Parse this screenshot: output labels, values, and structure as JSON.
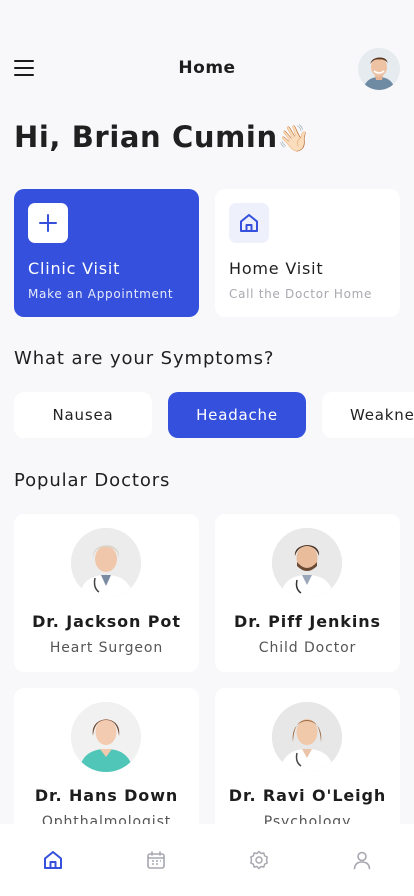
{
  "header": {
    "title": "Home",
    "menu_icon": "hamburger-menu-icon",
    "avatar_icon": "user-avatar"
  },
  "greeting": {
    "text": "Hi, Brian Cumin",
    "emoji": "👋🏻"
  },
  "visits": [
    {
      "title": "Clinic Visit",
      "subtitle": "Make an Appointment",
      "icon": "plus-icon",
      "active": true
    },
    {
      "title": "Home Visit",
      "subtitle": "Call the Doctor Home",
      "icon": "house-icon",
      "active": false
    }
  ],
  "symptoms": {
    "title": "What are your Symptoms?",
    "items": [
      {
        "label": "Nausea",
        "active": false
      },
      {
        "label": "Headache",
        "active": true
      },
      {
        "label": "Weakne",
        "active": false
      }
    ]
  },
  "doctors": {
    "title": "Popular Doctors",
    "items": [
      {
        "name": "Dr. Jackson Pot",
        "specialty": "Heart Surgeon"
      },
      {
        "name": "Dr. Piff Jenkins",
        "specialty": "Child Doctor"
      },
      {
        "name": "Dr. Hans Down",
        "specialty": "Ophthalmologist"
      },
      {
        "name": "Dr. Ravi O'Leigh",
        "specialty": "Psychology"
      }
    ]
  },
  "nav": {
    "items": [
      {
        "icon": "home-icon",
        "active": true
      },
      {
        "icon": "calendar-icon",
        "active": false
      },
      {
        "icon": "settings-gear-icon",
        "active": false
      },
      {
        "icon": "profile-icon",
        "active": false
      }
    ]
  },
  "colors": {
    "accent": "#3450dc",
    "background": "#f8f8fa",
    "card": "#ffffff",
    "nav_inactive": "#a7a7b0"
  }
}
